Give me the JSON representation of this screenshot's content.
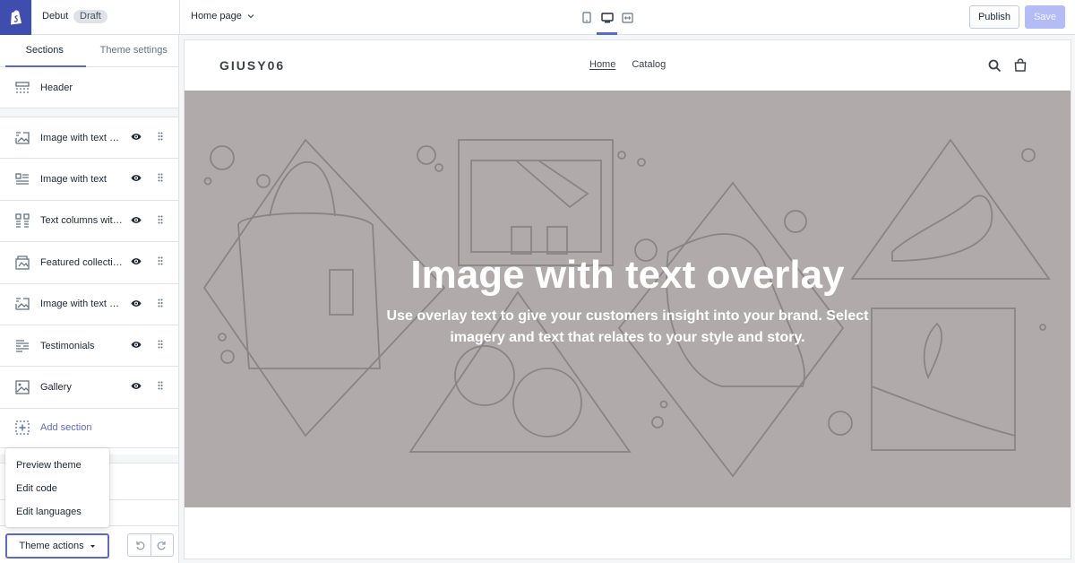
{
  "app": {
    "theme_name": "Debut",
    "status_badge": "Draft",
    "page_selector": "Home page",
    "publish_label": "Publish",
    "save_label": "Save",
    "accent_color": "#5c6ac4",
    "logo_color": "#3f4eae"
  },
  "sidebar": {
    "tabs": [
      "Sections",
      "Theme settings"
    ],
    "active_tab": "Sections",
    "header_label": "Header",
    "sections": [
      {
        "label": "Image with text overlay",
        "icon": "image-overlay-icon"
      },
      {
        "label": "Image with text",
        "icon": "image-text-icon"
      },
      {
        "label": "Text columns with images",
        "icon": "text-columns-icon"
      },
      {
        "label": "Featured collection",
        "icon": "collection-icon"
      },
      {
        "label": "Image with text overlay",
        "icon": "image-overlay-icon"
      },
      {
        "label": "Testimonials",
        "icon": "testimonials-icon"
      },
      {
        "label": "Gallery",
        "icon": "gallery-icon"
      }
    ],
    "add_section_label": "Add section",
    "theme_actions_label": "Theme actions",
    "theme_actions_menu": [
      "Preview theme",
      "Edit code",
      "Edit languages"
    ]
  },
  "preview": {
    "store_name": "GIUSY06",
    "nav": [
      "Home",
      "Catalog"
    ],
    "current_nav": "Home",
    "hero_title": "Image with text overlay",
    "hero_text": "Use overlay text to give your customers insight into your brand. Select imagery and text that relates to your style and story.",
    "hero_bg_color": "#b1aaab"
  }
}
